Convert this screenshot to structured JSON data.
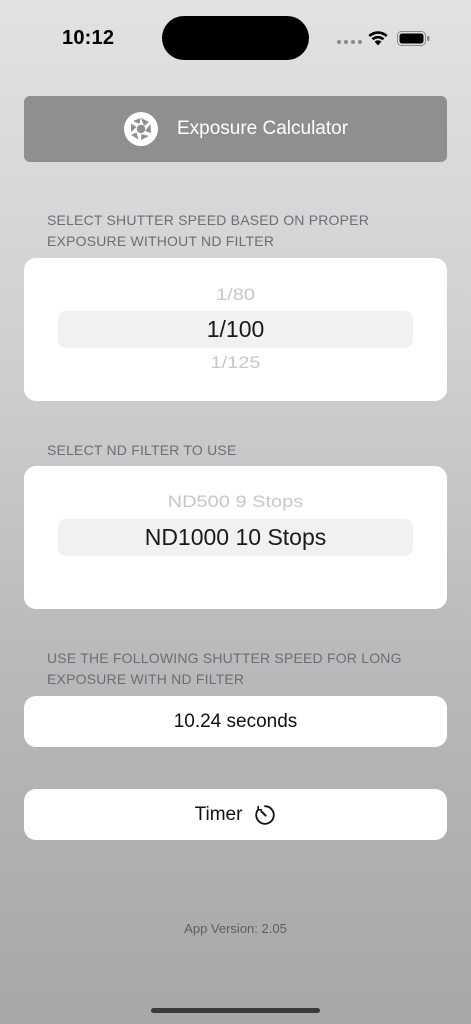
{
  "status_bar": {
    "time": "10:12"
  },
  "header": {
    "title": "Exposure Calculator",
    "icon": "aperture-icon"
  },
  "shutter_section": {
    "label": "SELECT SHUTTER SPEED BASED ON PROPER EXPOSURE WITHOUT ND FILTER",
    "picker": {
      "previous": "1/80",
      "selected": "1/100",
      "next": "1/125"
    }
  },
  "nd_section": {
    "label": "SELECT ND FILTER TO USE",
    "picker": {
      "previous": "ND500  9 Stops",
      "selected": "ND1000  10 Stops"
    }
  },
  "result_section": {
    "label": "USE THE FOLLOWING SHUTTER SPEED FOR LONG EXPOSURE WITH ND FILTER",
    "value": "10.24 seconds"
  },
  "timer": {
    "label": "Timer",
    "icon": "timer-icon"
  },
  "footer": {
    "version": "App Version: 2.05"
  },
  "colors": {
    "header_bg": "#8f8f92",
    "card_bg": "#ffffff",
    "label_text": "#6e6e72"
  }
}
